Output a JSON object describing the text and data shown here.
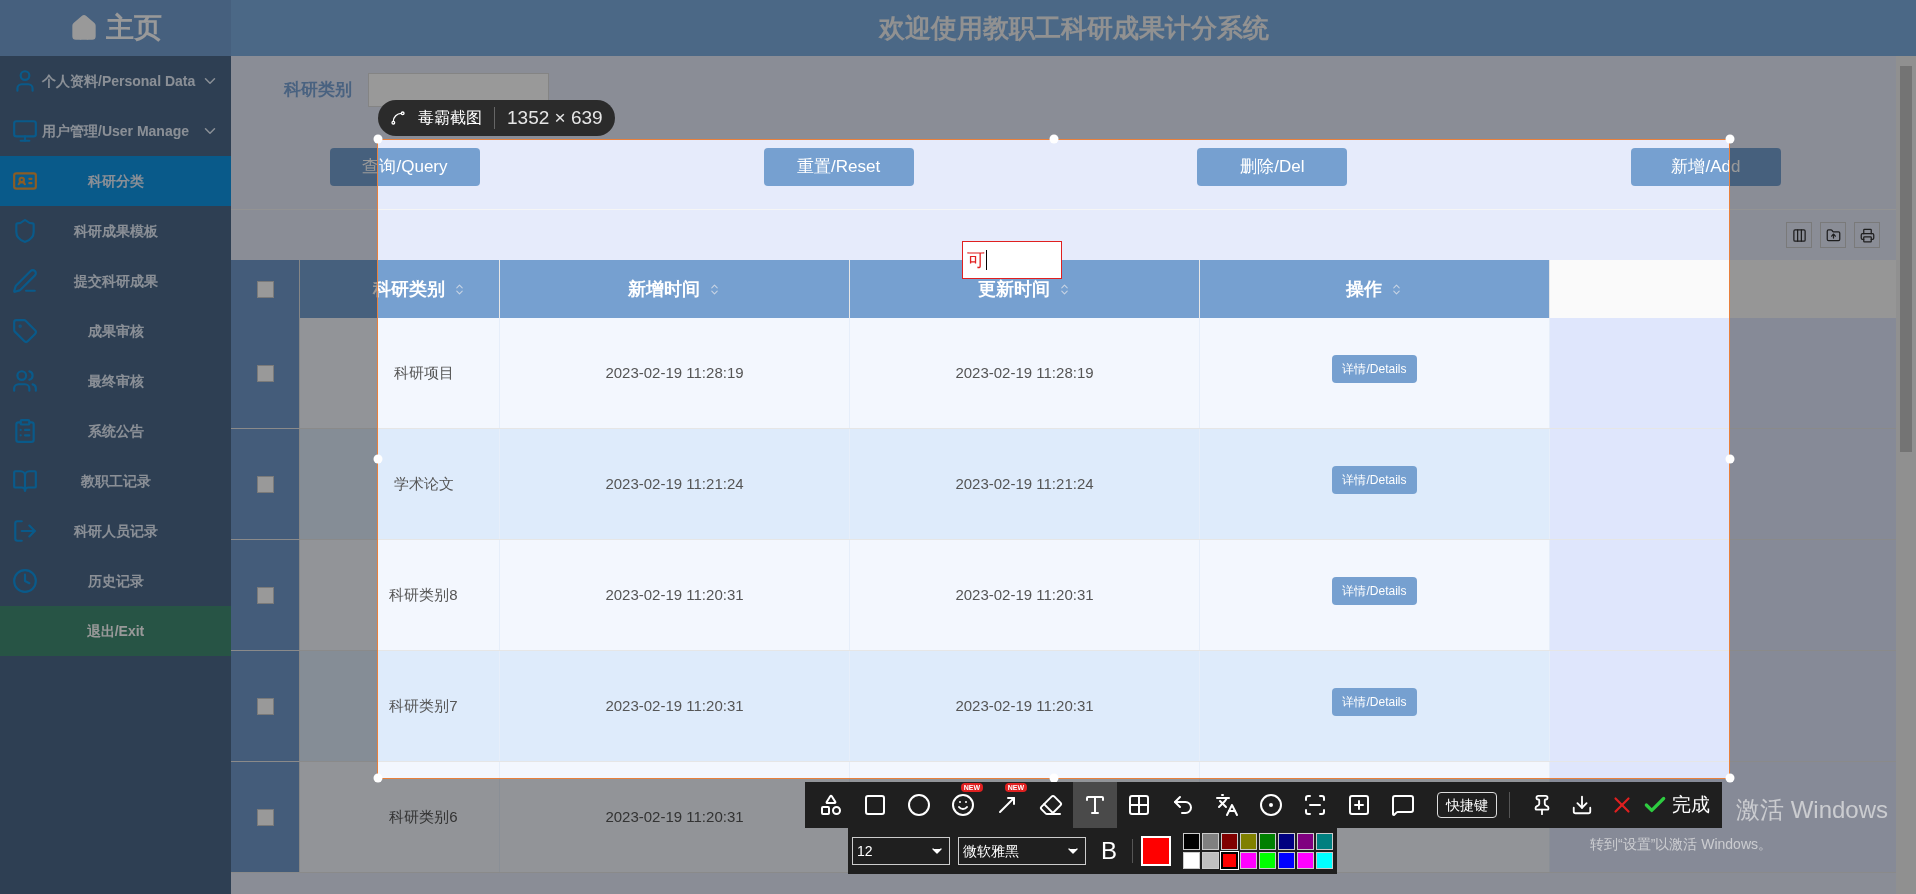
{
  "sidebar": {
    "home": "主页",
    "items": [
      {
        "label": "个人资料/Personal Data",
        "kind": "group",
        "selected": false
      },
      {
        "label": "用户管理/User Manage",
        "kind": "group",
        "selected": false
      },
      {
        "label": "科研分类",
        "kind": "link",
        "selected": true
      },
      {
        "label": "科研成果模板",
        "kind": "link",
        "selected": false
      },
      {
        "label": "提交科研成果",
        "kind": "link",
        "selected": false
      },
      {
        "label": "成果审核",
        "kind": "link",
        "selected": false
      },
      {
        "label": "最终审核",
        "kind": "link",
        "selected": false
      },
      {
        "label": "系统公告",
        "kind": "link",
        "selected": false
      },
      {
        "label": "教职工记录",
        "kind": "link",
        "selected": false
      },
      {
        "label": "科研人员记录",
        "kind": "link",
        "selected": false
      },
      {
        "label": "历史记录",
        "kind": "link",
        "selected": false
      },
      {
        "label": "退出/Exit",
        "kind": "exit",
        "selected": false
      }
    ]
  },
  "header": {
    "title": "欢迎使用教职工科研成果计分系统"
  },
  "search": {
    "label": "科研类别"
  },
  "buttons": [
    "查询/Query",
    "重置/Reset",
    "删除/Del",
    "新增/Add"
  ],
  "table": {
    "columns": [
      "科研类别",
      "新增时间",
      "更新时间",
      "操作"
    ],
    "header_checked": false,
    "rows": [
      {
        "checked": false,
        "category": "科研项目",
        "created": "2023-02-19 11:28:19",
        "updated": "2023-02-19 11:28:19",
        "action": "详情/Details"
      },
      {
        "checked": false,
        "category": "学术论文",
        "created": "2023-02-19 11:21:24",
        "updated": "2023-02-19 11:21:24",
        "action": "详情/Details"
      },
      {
        "checked": false,
        "category": "科研类别8",
        "created": "2023-02-19 11:20:31",
        "updated": "2023-02-19 11:20:31",
        "action": "详情/Details"
      },
      {
        "checked": false,
        "category": "科研类别7",
        "created": "2023-02-19 11:20:31",
        "updated": "2023-02-19 11:20:31",
        "action": "详情/Details"
      },
      {
        "checked": false,
        "category": "科研类别6",
        "created": "2023-02-19 11:20:31"
      }
    ]
  },
  "capture": {
    "brand": "毒霸截图",
    "size": "1352 × 639",
    "text_box": "可",
    "tools": [
      {
        "kind": "shapes",
        "selected": false
      },
      {
        "kind": "rect",
        "selected": false
      },
      {
        "kind": "circle",
        "selected": false
      },
      {
        "kind": "emoji",
        "selected": false,
        "badge": "NEW"
      },
      {
        "kind": "arrow",
        "selected": false,
        "badge": "NEW"
      },
      {
        "kind": "marker",
        "selected": false
      },
      {
        "kind": "text",
        "selected": true
      },
      {
        "kind": "mosaic",
        "selected": false
      },
      {
        "kind": "undo",
        "selected": false
      },
      {
        "kind": "translate",
        "selected": false
      },
      {
        "kind": "record",
        "selected": false
      },
      {
        "kind": "long",
        "selected": false
      },
      {
        "kind": "addframe",
        "selected": false
      },
      {
        "kind": "comment",
        "selected": false
      }
    ],
    "shortcut": "快捷键",
    "done": "完成",
    "font_size": "12",
    "font": "微软雅黑",
    "bold": "B",
    "palette": [
      {
        "color": "#000000",
        "selected": false
      },
      {
        "color": "#808080",
        "selected": false
      },
      {
        "color": "#800000",
        "selected": false
      },
      {
        "color": "#808000",
        "selected": false
      },
      {
        "color": "#008000",
        "selected": false
      },
      {
        "color": "#000080",
        "selected": false
      },
      {
        "color": "#800080",
        "selected": false
      },
      {
        "color": "#008080",
        "selected": false
      },
      {
        "color": "#ffffff",
        "selected": false
      },
      {
        "color": "#c0c0c0",
        "selected": false
      },
      {
        "color": "#ff0000",
        "selected": true
      },
      {
        "color": "#ff00ff",
        "selected": false
      },
      {
        "color": "#00ff00",
        "selected": false
      },
      {
        "color": "#0000ff",
        "selected": false
      },
      {
        "color": "#ff00ff",
        "selected": false
      },
      {
        "color": "#00ffff",
        "selected": false
      }
    ]
  },
  "watermark": [
    "激活 Windows",
    "转到“设置”以激活 Windows。"
  ]
}
